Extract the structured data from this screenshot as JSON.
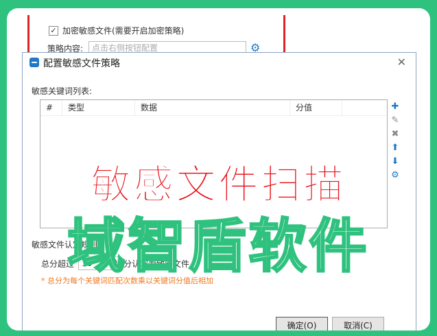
{
  "top_panel": {
    "encrypt_checkbox_label": "加密敏感文件(需要开启加密策略)",
    "strategy_label": "策略内容:",
    "strategy_placeholder": "点击右侧按钮配置",
    "config_icon": "gear-icon"
  },
  "dialog": {
    "title": "配置敏感文件策略",
    "close_label": "✕",
    "keyword_list_label": "敏感关键词列表:",
    "table": {
      "columns": [
        "#",
        "类型",
        "数据",
        "分值"
      ],
      "rows": []
    },
    "tools": [
      "plus-icon",
      "edit-icon",
      "delete-icon",
      "arrow-up-icon",
      "arrow-down-icon",
      "gear-icon"
    ],
    "rule_label": "敏感文件认定规则:",
    "rule_prefix": "总分超过",
    "score_value": "10",
    "rule_suffix": "分认定为敏感文件",
    "note": "* 总分为每个关键词匹配次数乘以关键词分值后相加",
    "ok_label": "确定(O)",
    "cancel_label": "取消(C)"
  },
  "watermark": {
    "line1": "敏感文件扫描",
    "line2": "域智盾软件"
  },
  "colors": {
    "background": "#2ec27e",
    "highlight_border": "#e02424",
    "accent": "#1e7ac8",
    "note": "#f07820",
    "watermark_red": "#e8101a"
  }
}
